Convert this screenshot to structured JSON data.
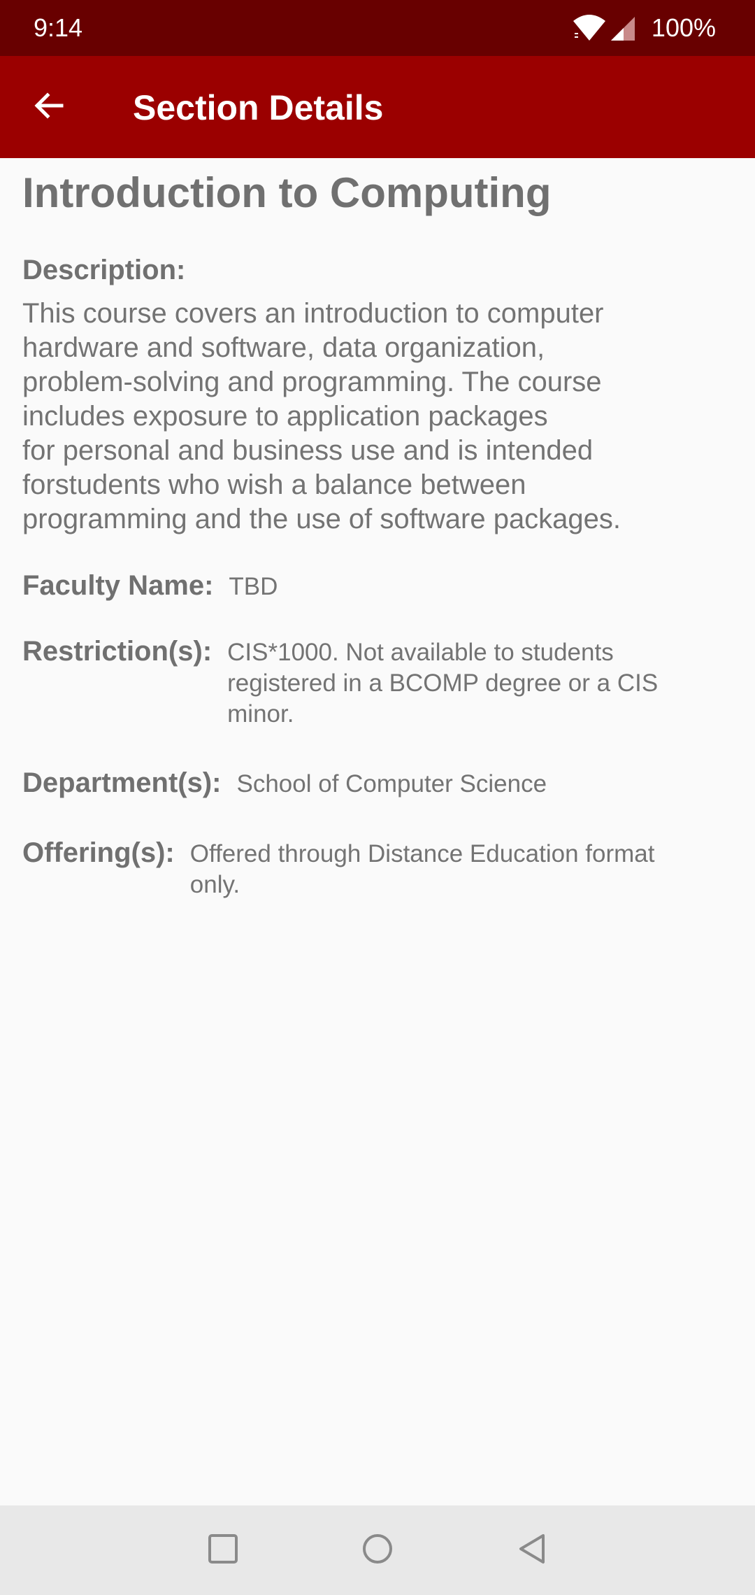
{
  "status_bar": {
    "time": "9:14",
    "battery": "100%",
    "icons": [
      "wifi-icon",
      "signal-icon"
    ]
  },
  "app_bar": {
    "title": "Section Details",
    "back_icon": "arrow-left-icon",
    "color": "#9b0000"
  },
  "course": {
    "title": "Introduction to Computing",
    "description_label": "Description:",
    "description": "This course covers an introduction to computer\nhardware and software, data organization,\nproblem-solving and programming. The course\nincludes exposure to application packages\nfor personal and business use and is intended\nforstudents who wish a balance between\nprogramming and the use of software packages."
  },
  "fields": {
    "faculty": {
      "label": "Faculty Name:",
      "value": "TBD"
    },
    "restrictions": {
      "label": "Restriction(s):",
      "value": "CIS*1000. Not available to students\nregistered in a BCOMP degree or a CIS\nminor."
    },
    "departments": {
      "label": "Department(s):",
      "value": "School of Computer Science"
    },
    "offerings": {
      "label": "Offering(s):",
      "value": "Offered through Distance Education format\nonly."
    }
  },
  "nav_bar": {
    "icons": [
      "square-recents-icon",
      "circle-home-icon",
      "triangle-back-icon"
    ]
  }
}
